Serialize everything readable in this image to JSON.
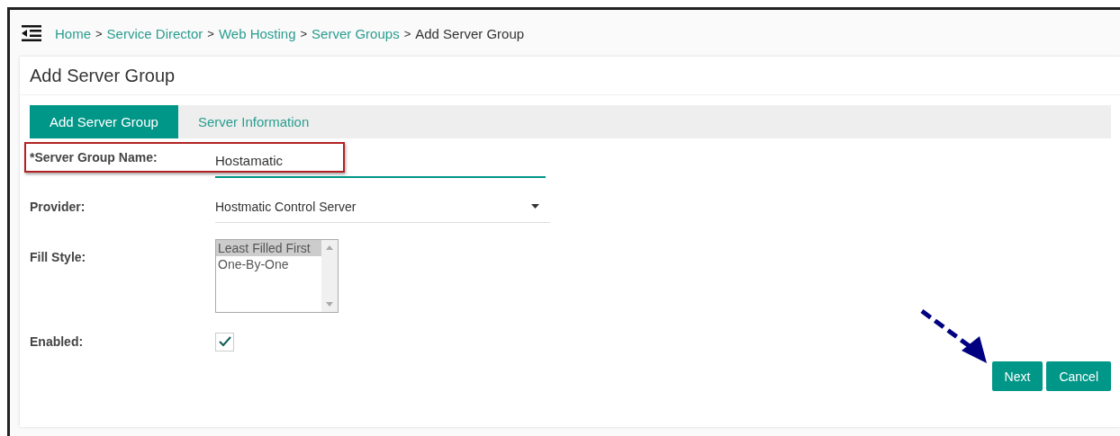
{
  "breadcrumb": [
    {
      "label": "Home",
      "link": true
    },
    {
      "label": "Service Director",
      "link": true
    },
    {
      "label": "Web Hosting",
      "link": true
    },
    {
      "label": "Server Groups",
      "link": true
    },
    {
      "label": "Add Server Group",
      "link": false
    }
  ],
  "breadcrumb_separator": ">",
  "card": {
    "title": "Add Server Group"
  },
  "tabs": [
    {
      "label": "Add Server Group",
      "selected": true
    },
    {
      "label": "Server Information",
      "selected": false
    }
  ],
  "form": {
    "name": {
      "label": "*Server Group Name:",
      "value": "Hostamatic",
      "highlighted": true
    },
    "provider": {
      "label": "Provider:",
      "value": "Hostmatic Control Server"
    },
    "fill_style": {
      "label": "Fill Style:",
      "options": [
        {
          "label": "Least Filled First",
          "selected": true
        },
        {
          "label": "One-By-One",
          "selected": false
        }
      ]
    },
    "enabled": {
      "label": "Enabled:",
      "checked": true
    }
  },
  "buttons": [
    {
      "label": "Next",
      "pointed_at": true
    },
    {
      "label": "Cancel",
      "pointed_at": false
    }
  ]
}
